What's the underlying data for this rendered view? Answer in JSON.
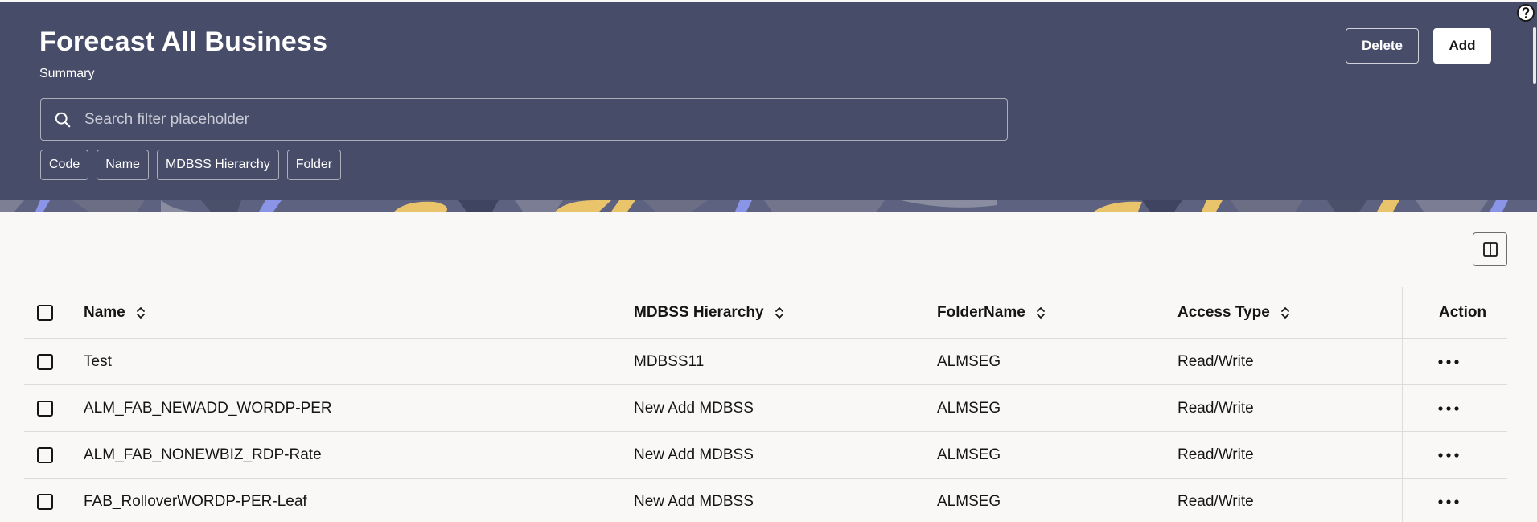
{
  "page": {
    "title": "Forecast All Business",
    "subtitle": "Summary"
  },
  "toolbar": {
    "delete_label": "Delete",
    "add_label": "Add"
  },
  "search": {
    "placeholder": "Search filter placeholder",
    "value": ""
  },
  "filters": [
    {
      "label": "Code"
    },
    {
      "label": "Name"
    },
    {
      "label": "MDBSS Hierarchy"
    },
    {
      "label": "Folder"
    }
  ],
  "table": {
    "columns": {
      "name": "Name",
      "hierarchy": "MDBSS Hierarchy",
      "folder": "FolderName",
      "access": "Access Type",
      "action": "Action"
    },
    "rows": [
      {
        "name": "Test",
        "hierarchy": "MDBSS11",
        "folder": "ALMSEG",
        "access": "Read/Write"
      },
      {
        "name": "ALM_FAB_NEWADD_WORDP-PER",
        "hierarchy": "New Add MDBSS",
        "folder": "ALMSEG",
        "access": "Read/Write"
      },
      {
        "name": "ALM_FAB_NONEWBIZ_RDP-Rate",
        "hierarchy": "New Add MDBSS",
        "folder": "ALMSEG",
        "access": "Read/Write"
      },
      {
        "name": "FAB_RolloverWORDP-PER-Leaf",
        "hierarchy": "New Add MDBSS",
        "folder": "ALMSEG",
        "access": "Read/Write"
      }
    ]
  },
  "icons": {
    "help": "help-circle-icon",
    "search": "search-icon",
    "column_toggle": "column-layout-icon",
    "sort": "sort-icon",
    "more": "more-horizontal-icon"
  },
  "colors": {
    "header_bg": "#474c68",
    "page_bg": "#f9f8f6",
    "text": "#161513",
    "pattern_yellow": "#e9c46a",
    "pattern_blue": "#8a95e8"
  }
}
